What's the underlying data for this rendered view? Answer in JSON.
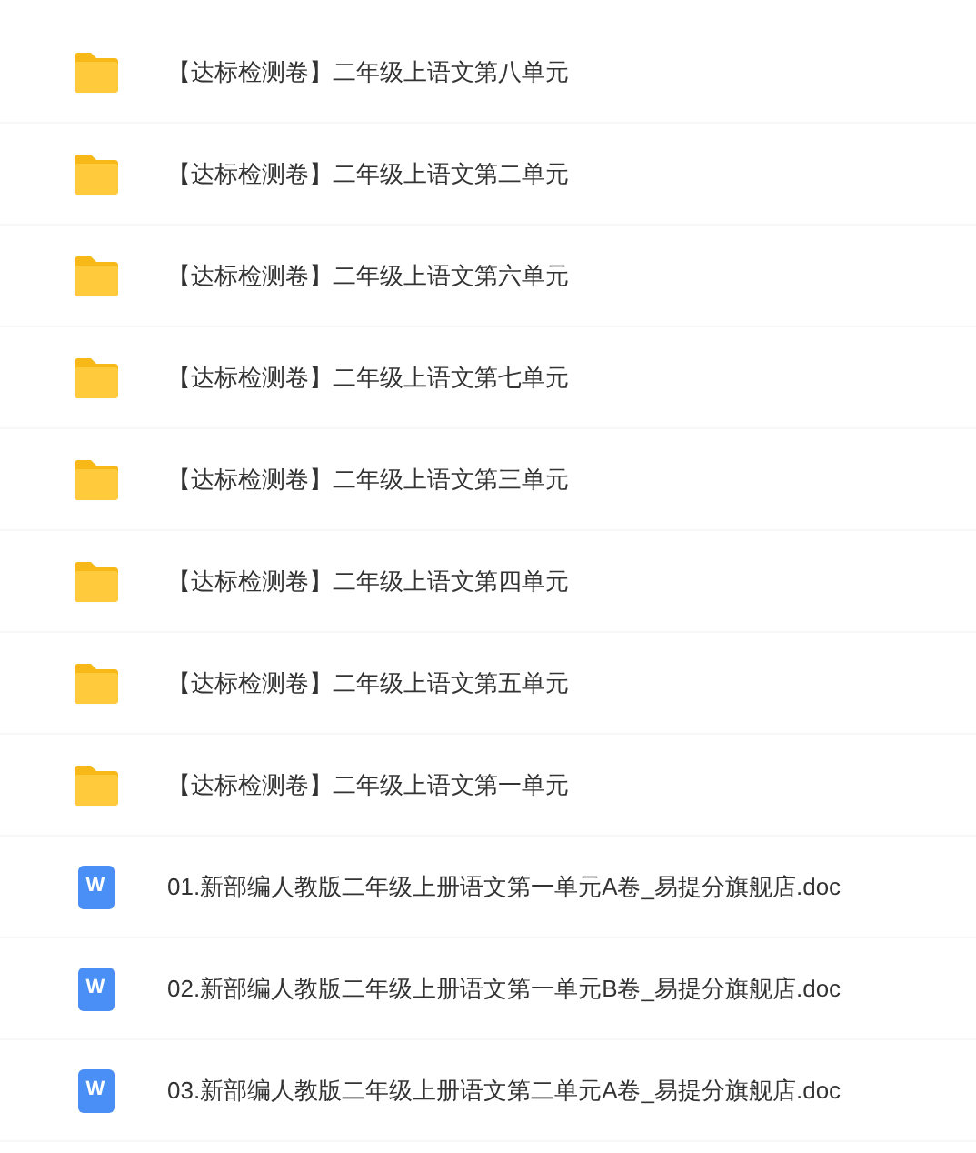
{
  "files": [
    {
      "kind": "folder",
      "name": "【达标检测卷】二年级上语文第八单元"
    },
    {
      "kind": "folder",
      "name": "【达标检测卷】二年级上语文第二单元"
    },
    {
      "kind": "folder",
      "name": "【达标检测卷】二年级上语文第六单元"
    },
    {
      "kind": "folder",
      "name": "【达标检测卷】二年级上语文第七单元"
    },
    {
      "kind": "folder",
      "name": "【达标检测卷】二年级上语文第三单元"
    },
    {
      "kind": "folder",
      "name": "【达标检测卷】二年级上语文第四单元"
    },
    {
      "kind": "folder",
      "name": "【达标检测卷】二年级上语文第五单元"
    },
    {
      "kind": "folder",
      "name": "【达标检测卷】二年级上语文第一单元"
    },
    {
      "kind": "doc",
      "icon_letter": "W",
      "name": "01.新部编人教版二年级上册语文第一单元A卷_易提分旗舰店.doc"
    },
    {
      "kind": "doc",
      "icon_letter": "W",
      "name": "02.新部编人教版二年级上册语文第一单元B卷_易提分旗舰店.doc"
    },
    {
      "kind": "doc",
      "icon_letter": "W",
      "name": "03.新部编人教版二年级上册语文第二单元A卷_易提分旗舰店.doc"
    }
  ]
}
